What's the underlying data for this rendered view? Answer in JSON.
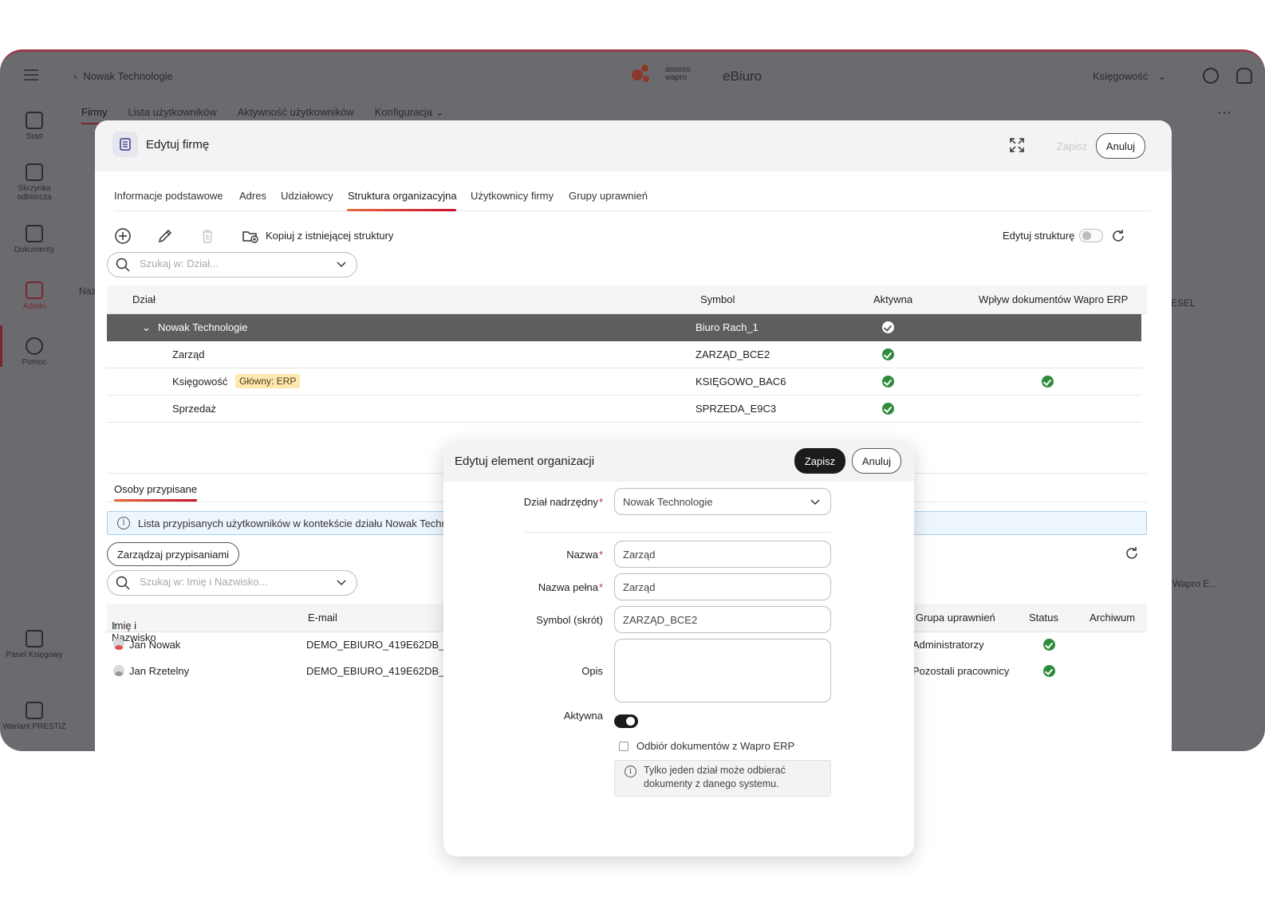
{
  "app": {
    "breadcrumb": "Nowak Technologie",
    "brand_line1": "asseco",
    "brand_line2": "wapro",
    "name": "eBiuro",
    "role": "Księgowość",
    "subtabs": [
      "Firmy",
      "Lista użytkowników",
      "Aktywność użytkowników",
      "Konfiguracja"
    ],
    "sidebar": [
      {
        "label": "Start",
        "icon": "home-icon"
      },
      {
        "label": "Skrzynka odbiorcza",
        "icon": "inbox-icon"
      },
      {
        "label": "Dokumenty",
        "icon": "documents-icon"
      },
      {
        "label": "Admin",
        "icon": "admin-gears-icon"
      },
      {
        "label": "Pomoc",
        "icon": "help-icon"
      },
      {
        "label": "Panel Księgowy",
        "icon": "panel-icon"
      },
      {
        "label": "Wariant PRESTIŻ",
        "icon": "variant-icon"
      }
    ],
    "bg_fragments": {
      "col_pesel": "ESEL",
      "col_name": "Naz",
      "col_wapro": "Wapro E..."
    }
  },
  "modal": {
    "title": "Edytuj firmę",
    "save_label": "Zapisz",
    "cancel_label": "Anuluj",
    "tabs": [
      "Informacje podstawowe",
      "Adres",
      "Udziałowcy",
      "Struktura organizacyjna",
      "Użytkownicy firmy",
      "Grupy uprawnień"
    ],
    "active_tab": "Struktura organizacyjna",
    "toolbar": {
      "copy_label": "Kopiuj z istniejącej struktury",
      "edit_structure_label": "Edytuj strukturę",
      "edit_structure_on": false
    },
    "dept_search_placeholder": "Szukaj w: Dział...",
    "grid": {
      "columns": [
        "Dział",
        "Symbol",
        "Aktywna",
        "Wpływ dokumentów Wapro ERP"
      ],
      "rows": [
        {
          "name": "Nowak Technologie",
          "symbol": "Biuro Rach_1",
          "active": true,
          "erp": false,
          "badge": "",
          "level": 0,
          "selected": true
        },
        {
          "name": "Zarząd",
          "symbol": "ZARZĄD_BCE2",
          "active": true,
          "erp": false,
          "badge": "",
          "level": 1,
          "selected": false
        },
        {
          "name": "Księgowość",
          "symbol": "KSIĘGOWO_BAC6",
          "active": true,
          "erp": true,
          "badge": "Główny: ERP",
          "level": 1,
          "selected": false
        },
        {
          "name": "Sprzedaż",
          "symbol": "SPRZEDA_E9C3",
          "active": true,
          "erp": false,
          "badge": "",
          "level": 1,
          "selected": false
        }
      ]
    },
    "assigned": {
      "tab_label": "Osoby przypisane",
      "info_text": "Lista przypisanych użytkowników w kontekście działu Nowak Techn",
      "manage_label": "Zarządzaj przypisaniami",
      "search_placeholder": "Szukaj w: Imię i Nazwisko...",
      "columns": [
        "Imię i Nazwisko",
        "E-mail",
        "Grupa uprawnień",
        "Status",
        "Archiwum"
      ],
      "sort_indicator": "↑",
      "rows": [
        {
          "name": "Jan Nowak",
          "email": "DEMO_EBIURO_419E62DB_A",
          "group": "Administratorzy",
          "status": true
        },
        {
          "name": "Jan Rzetelny",
          "email": "DEMO_EBIURO_419E62DB_A",
          "group": "Pozostali pracownicy",
          "status": true
        }
      ]
    }
  },
  "dialog": {
    "title": "Edytuj element organizacji",
    "save_label": "Zapisz",
    "cancel_label": "Anuluj",
    "parent_label": "Dział nadrzędny",
    "parent_value": "Nowak Technologie",
    "name_label": "Nazwa",
    "name_value": "Zarząd",
    "full_name_label": "Nazwa pełna",
    "full_name_value": "Zarząd",
    "symbol_label": "Symbol (skrót)",
    "symbol_value": "ZARZĄD_BCE2",
    "description_label": "Opis",
    "description_value": "",
    "active_label": "Aktywna",
    "active_on": true,
    "erp_checkbox_label": "Odbiór dokumentów z Wapro ERP",
    "erp_checked": false,
    "hint_line1": "Tylko jeden dział może odbierać",
    "hint_line2": "dokumenty z danego systemu.",
    "required_mark": "*"
  },
  "colors": {
    "accent": "#c8102e",
    "accent_orange": "#e86a3e",
    "success": "#2e8b3e",
    "dark_button": "#1b1b1b",
    "selected_row": "#5e5e60",
    "badge_bg": "#fde9b0"
  }
}
